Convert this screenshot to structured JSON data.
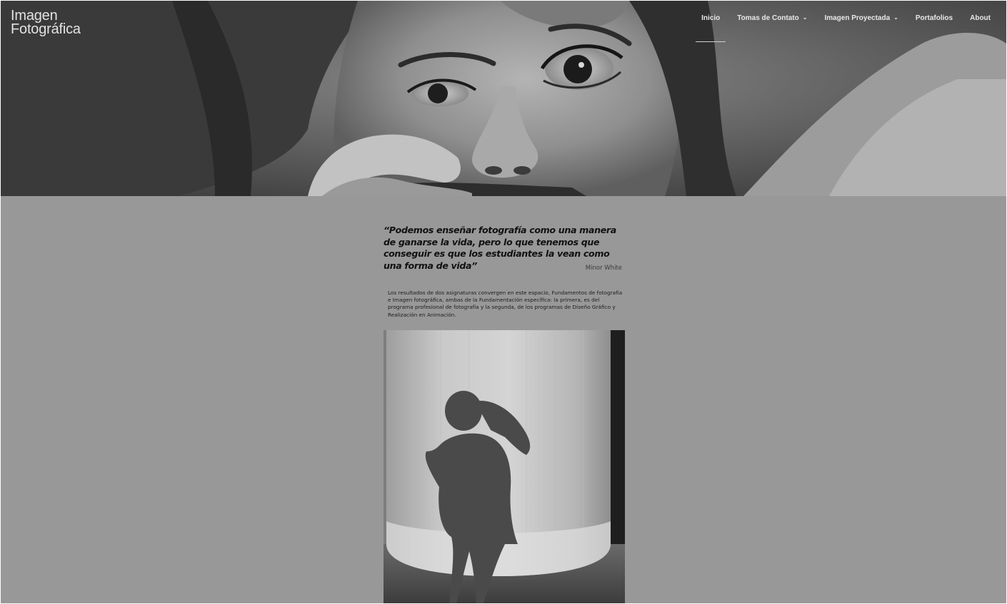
{
  "header": {
    "logo_line1": "Imagen",
    "logo_line2": "Fotográfica",
    "nav": [
      {
        "label": "Inicio",
        "active": true,
        "dropdown": false
      },
      {
        "label": "Tomas de Contato",
        "active": false,
        "dropdown": true
      },
      {
        "label": "Imagen Proyectada",
        "active": false,
        "dropdown": true
      },
      {
        "label": "Portafolios",
        "active": false,
        "dropdown": false
      },
      {
        "label": "About",
        "active": false,
        "dropdown": false
      }
    ],
    "caret_glyph": "⌄"
  },
  "main": {
    "quote": "“Podemos enseñar fotografía como una manera de ganarse la vida, pero lo que tenemos que conseguir es que los estudiantes la vean como una forma de vida”",
    "author": "Minor White",
    "paragraph": "Los resultados de dos asignaturas convergen en este espacio, Fundamentos de fotografía e Imagen fotográfica, ambas de la Fundamentación específica: la primera, es del programa profesional de fotografía y la segunda, de los programas de Diseño Gráfico y Realización en Animación."
  },
  "colors": {
    "page_overlay": "#989898",
    "text_dark": "#111111",
    "nav_text": "#e8e8e8"
  },
  "icons": {
    "dropdown": "chevron-down-icon"
  }
}
